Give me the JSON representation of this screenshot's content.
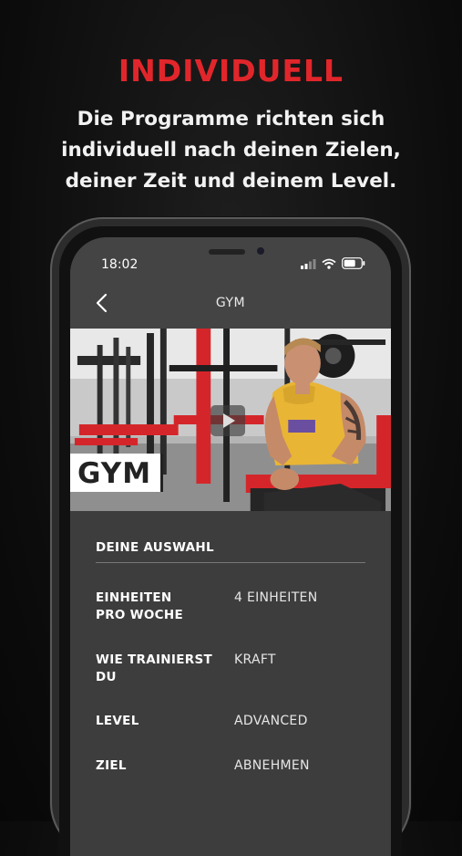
{
  "promo": {
    "headline": "INDIVIDUELL",
    "subline_lines": [
      "Die Programme richten sich",
      "individuell nach deinen Zielen,",
      "deiner Zeit und deinem Level."
    ]
  },
  "status_bar": {
    "time": "18:02",
    "icons": [
      "signal-icon",
      "wifi-icon",
      "battery-icon"
    ]
  },
  "navbar": {
    "back_icon": "chevron-left-icon",
    "title": "GYM"
  },
  "hero": {
    "overlay_label": "GYM",
    "play_icon": "play-icon"
  },
  "details": {
    "section_title": "DEINE AUSWAHL",
    "rows": [
      {
        "label_lines": [
          "EINHEITEN",
          "PRO WOCHE"
        ],
        "value": "4 EINHEITEN"
      },
      {
        "label_lines": [
          "WIE TRAINIERST",
          "DU"
        ],
        "value": "KRAFT"
      },
      {
        "label_lines": [
          "LEVEL"
        ],
        "value": "ADVANCED"
      },
      {
        "label_lines": [
          "ZIEL"
        ],
        "value": "ABNEHMEN"
      }
    ]
  },
  "colors": {
    "accent_red": "#e1262b",
    "background": "#0c0c0c",
    "screen_bg": "#3d3d3d",
    "jersey_yellow": "#e9b535"
  }
}
